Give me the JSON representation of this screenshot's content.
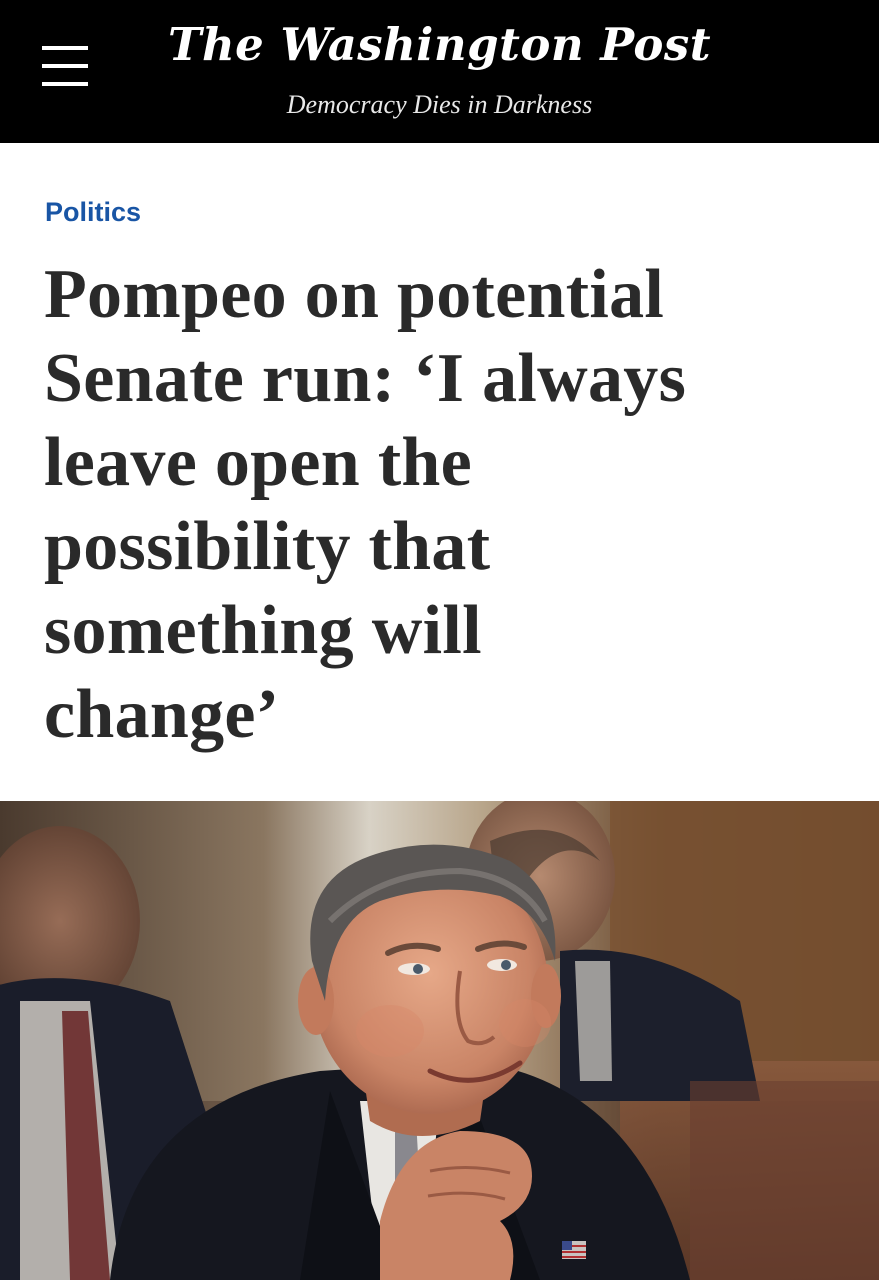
{
  "header": {
    "logo_text": "The Washington Post",
    "tagline": "Democracy Dies in Darkness",
    "menu_icon": "hamburger-menu-icon"
  },
  "article": {
    "section": "Politics",
    "headline_lines": [
      "Pompeo on potential",
      "Senate run: ‘I always",
      "leave open the",
      "possibility that",
      "something will",
      "change’"
    ]
  },
  "colors": {
    "header_bg": "#000000",
    "section_link": "#1955a5",
    "headline_text": "#2a2a2a"
  }
}
